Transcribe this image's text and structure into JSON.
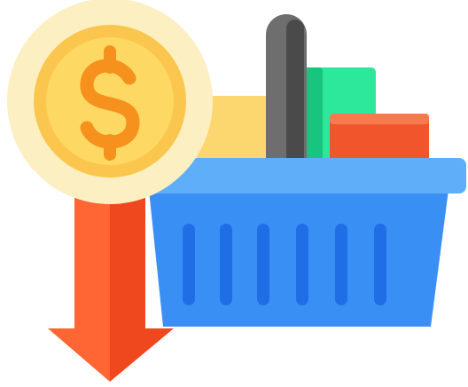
{
  "icon": {
    "name": "price-drop-basket-icon",
    "elements": [
      "dollar-coin-icon",
      "dollar-sign-icon",
      "down-arrow-icon",
      "shopping-basket-icon",
      "basket-handle-icon",
      "basket-item-icon"
    ]
  },
  "colors": {
    "coin_halo": "#FCEFC2",
    "coin_outer": "#FBC64E",
    "coin_inner": "#FDD862",
    "dollar_sign": "#F6911E",
    "arrow_light": "#FF6633",
    "arrow_dark": "#F0481E",
    "basket_body": "#3A8FF5",
    "basket_rim": "#5EAEFA",
    "basket_slots": "#1F6EE6",
    "handle_light": "#6E6E6E",
    "handle_dark": "#4A4A4A",
    "item_yellow": "#FCD66E",
    "item_green_light": "#2DE89A",
    "item_green_dark": "#18C47E",
    "item_red": "#F0552B",
    "item_red_top": "#F77A4E"
  }
}
